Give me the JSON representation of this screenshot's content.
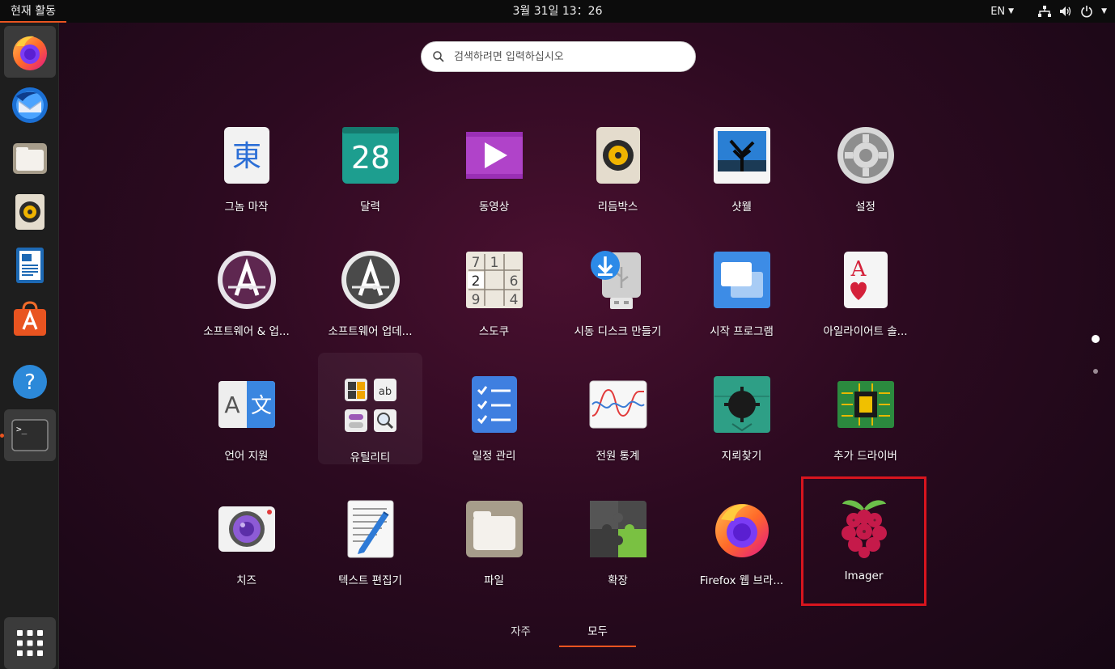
{
  "topbar": {
    "activities": "현재 활동",
    "clock": "3월 31일  13：26",
    "lang": "EN"
  },
  "dock": {
    "items": [
      {
        "name": "firefox",
        "icon": "firefox-icon"
      },
      {
        "name": "thunderbird",
        "icon": "thunderbird-icon"
      },
      {
        "name": "files",
        "icon": "folder-icon"
      },
      {
        "name": "rhythmbox",
        "icon": "speaker-icon"
      },
      {
        "name": "libreoffice-writer",
        "icon": "document-icon"
      },
      {
        "name": "ubuntu-software",
        "icon": "shopping-bag-icon"
      },
      {
        "name": "help",
        "icon": "question-icon"
      },
      {
        "name": "terminal",
        "icon": "terminal-icon"
      },
      {
        "name": "show-applications",
        "icon": "grid-icon"
      }
    ]
  },
  "search": {
    "placeholder": "검색하려면 입력하십시오"
  },
  "apps": [
    {
      "label": "그놈 마작",
      "icon": "mahjongg-icon"
    },
    {
      "label": "달력",
      "icon": "calendar-icon",
      "day": "28"
    },
    {
      "label": "동영상",
      "icon": "video-icon"
    },
    {
      "label": "리듬박스",
      "icon": "speaker-icon"
    },
    {
      "label": "샷웰",
      "icon": "photo-icon"
    },
    {
      "label": "설정",
      "icon": "gear-icon"
    },
    {
      "label": "소프트웨어 & 업...",
      "icon": "software-update-icon"
    },
    {
      "label": "소프트웨어 업데...",
      "icon": "software-updater-icon"
    },
    {
      "label": "스도쿠",
      "icon": "sudoku-icon",
      "digits": [
        "7",
        "1",
        "2",
        "6",
        "9",
        "4"
      ]
    },
    {
      "label": "시동 디스크 만들기",
      "icon": "usb-icon"
    },
    {
      "label": "시작 프로그램",
      "icon": "windows-icon"
    },
    {
      "label": "아일라이어트 솔...",
      "icon": "card-icon",
      "card": "A"
    },
    {
      "label": "언어 지원",
      "icon": "language-icon",
      "glyph_a": "A",
      "glyph_b": "文"
    },
    {
      "label": "유틸리티",
      "icon": "utilities-folder-icon",
      "glyph": "ab"
    },
    {
      "label": "일정 관리",
      "icon": "todo-icon"
    },
    {
      "label": "전원 통계",
      "icon": "power-stats-icon"
    },
    {
      "label": "지뢰찾기",
      "icon": "mine-icon"
    },
    {
      "label": "추가 드라이버",
      "icon": "chip-icon"
    },
    {
      "label": "치즈",
      "icon": "camera-icon"
    },
    {
      "label": "텍스트 편집기",
      "icon": "text-editor-icon"
    },
    {
      "label": "파일",
      "icon": "folder-icon"
    },
    {
      "label": "확장",
      "icon": "puzzle-icon"
    },
    {
      "label": "Firefox 웹 브라...",
      "icon": "firefox-icon"
    },
    {
      "label": "Imager",
      "icon": "raspberry-icon"
    }
  ],
  "switcher": {
    "frequent": "자주",
    "all": "모두"
  },
  "colors": {
    "accent": "#e95420",
    "highlight": "#d8151e"
  }
}
